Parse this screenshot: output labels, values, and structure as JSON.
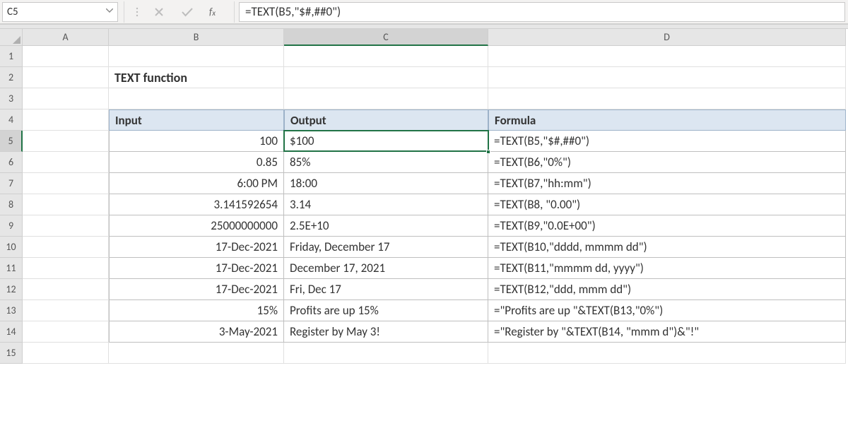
{
  "nameBox": "C5",
  "formulaBar": "=TEXT(B5,\"$#,##0\")",
  "columns": [
    "A",
    "B",
    "C",
    "D"
  ],
  "rows": [
    "1",
    "2",
    "3",
    "4",
    "5",
    "6",
    "7",
    "8",
    "9",
    "10",
    "11",
    "12",
    "13",
    "14",
    "15"
  ],
  "activeCell": {
    "col": "C",
    "row": "5"
  },
  "title": "TEXT function",
  "headers": {
    "input": "Input",
    "output": "Output",
    "formula": "Formula"
  },
  "data": [
    {
      "input": "100",
      "output": "$100",
      "formula": "=TEXT(B5,\"$#,##0\")"
    },
    {
      "input": "0.85",
      "output": "85%",
      "formula": "=TEXT(B6,\"0%\")"
    },
    {
      "input": "6:00 PM",
      "output": "18:00",
      "formula": "=TEXT(B7,\"hh:mm\")"
    },
    {
      "input": "3.141592654",
      "output": "3.14",
      "formula": "=TEXT(B8, \"0.00\")"
    },
    {
      "input": "25000000000",
      "output": "2.5E+10",
      "formula": "=TEXT(B9,\"0.0E+00\")"
    },
    {
      "input": "17-Dec-2021",
      "output": "Friday, December 17",
      "formula": "=TEXT(B10,\"dddd, mmmm dd\")"
    },
    {
      "input": "17-Dec-2021",
      "output": "December 17, 2021",
      "formula": "=TEXT(B11,\"mmmm dd, yyyy\")"
    },
    {
      "input": "17-Dec-2021",
      "output": "Fri, Dec 17",
      "formula": "=TEXT(B12,\"ddd, mmm dd\")"
    },
    {
      "input": "15%",
      "output": "Profits are up 15%",
      "formula": "=\"Profits are up \"&TEXT(B13,\"0%\")"
    },
    {
      "input": "3-May-2021",
      "output": "Register by May 3!",
      "formula": "=\"Register by \"&TEXT(B14, \"mmm d\")&\"!\""
    }
  ]
}
